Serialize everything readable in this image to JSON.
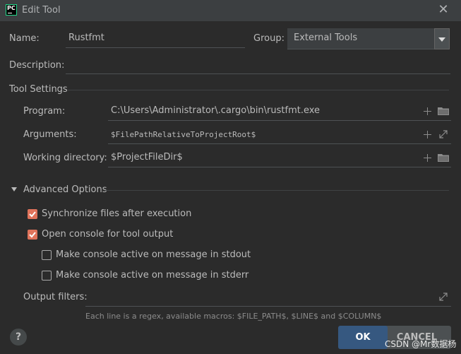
{
  "window": {
    "title": "Edit Tool",
    "app_badge": "PC"
  },
  "form": {
    "name_label": "Name:",
    "name_value": "Rustfmt",
    "group_label": "Group:",
    "group_value": "External Tools",
    "description_label": "Description:",
    "description_value": ""
  },
  "tool_settings": {
    "header": "Tool Settings",
    "program_label": "Program:",
    "program_value": "C:\\Users\\Administrator\\.cargo\\bin\\rustfmt.exe",
    "arguments_label": "Arguments:",
    "arguments_value": "$FilePathRelativeToProjectRoot$",
    "workdir_label": "Working directory:",
    "workdir_value": "$ProjectFileDir$"
  },
  "advanced": {
    "header": "Advanced Options",
    "options": [
      {
        "label": "Synchronize files after execution",
        "checked": true
      },
      {
        "label": "Open console for tool output",
        "checked": true
      },
      {
        "label": "Make console active on message in stdout",
        "checked": false
      },
      {
        "label": "Make console active on message in stderr",
        "checked": false
      }
    ],
    "output_filters_label": "Output filters:",
    "output_filters_value": "",
    "hint": "Each line is a regex, available macros: $FILE_PATH$, $LINE$ and $COLUMN$"
  },
  "buttons": {
    "help": "?",
    "ok": "OK",
    "cancel": "CANCEL"
  },
  "watermark": "CSDN @Mr数据杨",
  "colors": {
    "accent_checkbox": "#e0735b",
    "ok_button": "#365880",
    "background": "#2b2b2b"
  }
}
